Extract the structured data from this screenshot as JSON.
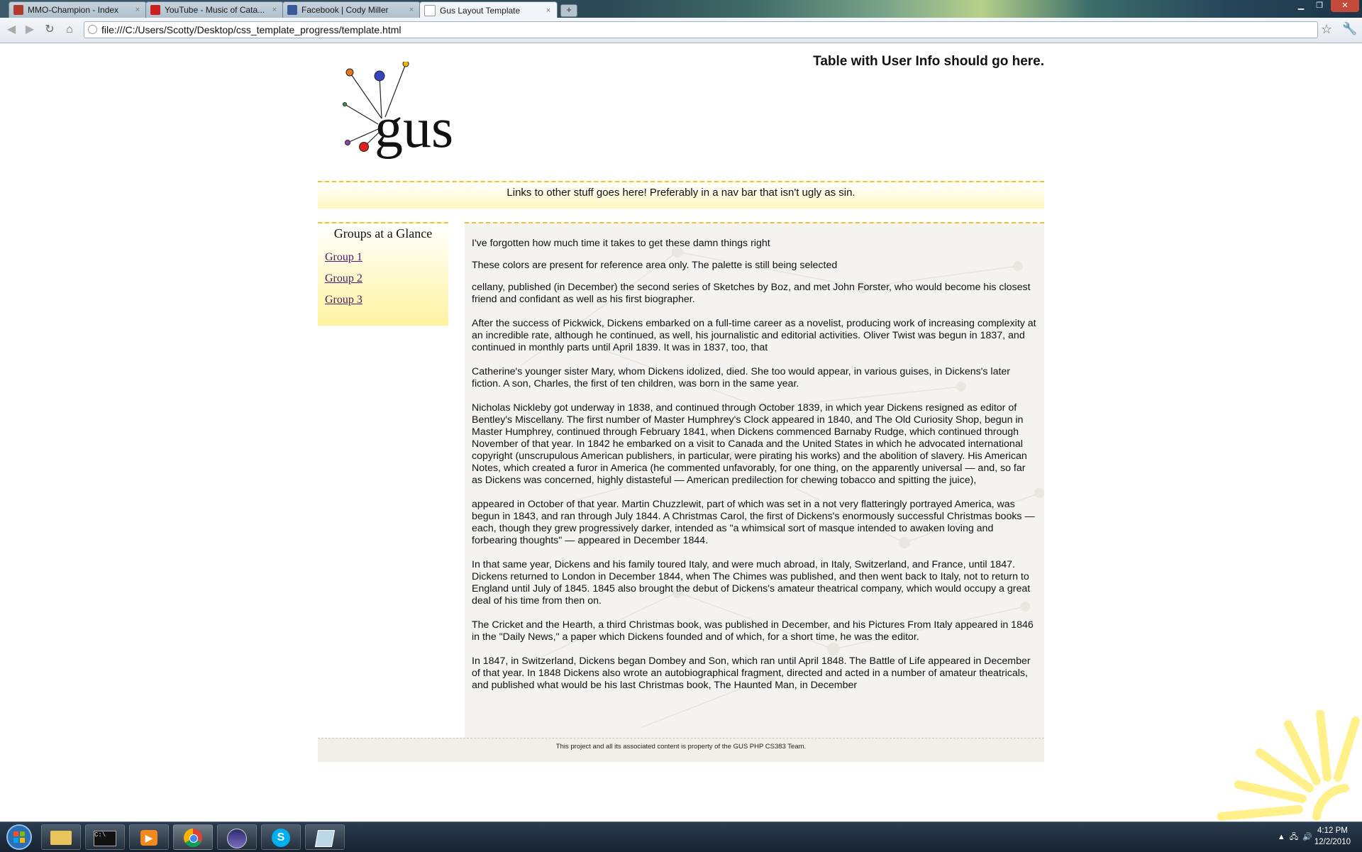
{
  "browser": {
    "tabs": [
      {
        "label": "MMO-Champion - Index",
        "favicon_color": "#b33a2b"
      },
      {
        "label": "YouTube - Music of Cata...",
        "favicon_color": "#cc1f1f"
      },
      {
        "label": "Facebook | Cody Miller",
        "favicon_color": "#3b5998"
      },
      {
        "label": "Gus Layout Template",
        "favicon_color": "#dddddd"
      }
    ],
    "new_tab_symbol": "+",
    "close_symbol": "×",
    "address": "file:///C:/Users/Scotty/Desktop/css_template_progress/template.html"
  },
  "page": {
    "user_info": "Table with User Info should go here.",
    "nav_text": "Links to other stuff goes here! Preferably in a nav bar that isn't ugly as sin.",
    "sidebar": {
      "title": "Groups at a Glance",
      "links": [
        "Group 1",
        "Group 2",
        "Group 3"
      ]
    },
    "content": {
      "paragraphs": [
        "I've forgotten how much time it takes to get these damn things right",
        "These colors are present for reference area only. The palette is still being selected",
        "cellany, published (in December) the second series of Sketches by Boz, and met John Forster, who would become his closest friend and confidant as well as his first biographer.",
        "After the success of Pickwick, Dickens embarked on a full-time career as a novelist, producing work of increasing complexity at an incredible rate, although he continued, as well, his journalistic and editorial activities. Oliver Twist was begun in 1837, and continued in monthly parts until April 1839. It was in 1837, too, that",
        "Catherine's younger sister Mary, whom Dickens idolized, died. She too would appear, in various guises, in Dickens's later fiction. A son, Charles, the first of ten children, was born in the same year.",
        "Nicholas Nickleby got underway in 1838, and continued through October 1839, in which year Dickens resigned as editor of Bentley's Miscellany. The first number of Master Humphrey's Clock appeared in 1840, and The Old Curiosity Shop, begun in Master Humphrey, continued through February 1841, when Dickens commenced Barnaby Rudge, which continued through November of that year. In 1842 he embarked on a visit to Canada and the United States in which he advocated international copyright (unscrupulous American publishers, in particular, were pirating his works) and the abolition of slavery. His American Notes, which created a furor in America (he commented unfavorably, for one thing, on the apparently universal — and, so far as Dickens was concerned, highly distasteful — American predilection for chewing tobacco and spitting the juice),",
        "appeared in October of that year. Martin Chuzzlewit, part of which was set in a not very flatteringly portrayed America, was begun in 1843, and ran through July 1844. A Christmas Carol, the first of Dickens's enormously successful Christmas books — each, though they grew progressively darker, intended as \"a whimsical sort of masque intended to awaken loving and forbearing thoughts\" — appeared in December 1844.",
        "In that same year, Dickens and his family toured Italy, and were much abroad, in Italy, Switzerland, and France, until 1847. Dickens returned to London in December 1844, when The Chimes was published, and then went back to Italy, not to return to England until July of 1845. 1845 also brought the debut of Dickens's amateur theatrical company, which would occupy a great deal of his time from then on.",
        "The Cricket and the Hearth, a third Christmas book, was published in December, and his Pictures From Italy appeared in 1846 in the \"Daily News,\" a paper which Dickens founded and of which, for a short time, he was the editor.",
        "In 1847, in Switzerland, Dickens began Dombey and Son, which ran until April 1848. The Battle of Life appeared in December of that year. In 1848 Dickens also wrote an autobiographical fragment, directed and acted in a number of amateur theatricals, and published what would be his last Christmas book, The Haunted Man, in December"
      ]
    },
    "footer": "This project and all its associated content is property of the GUS PHP CS383 Team.",
    "logo_text": "gus",
    "accent_color": "#f1c232"
  },
  "taskbar": {
    "time": "4:12 PM",
    "date": "12/2/2010",
    "apps": [
      "windows-explorer",
      "command-prompt",
      "media-player",
      "chrome",
      "eclipse",
      "skype",
      "notepad"
    ]
  }
}
